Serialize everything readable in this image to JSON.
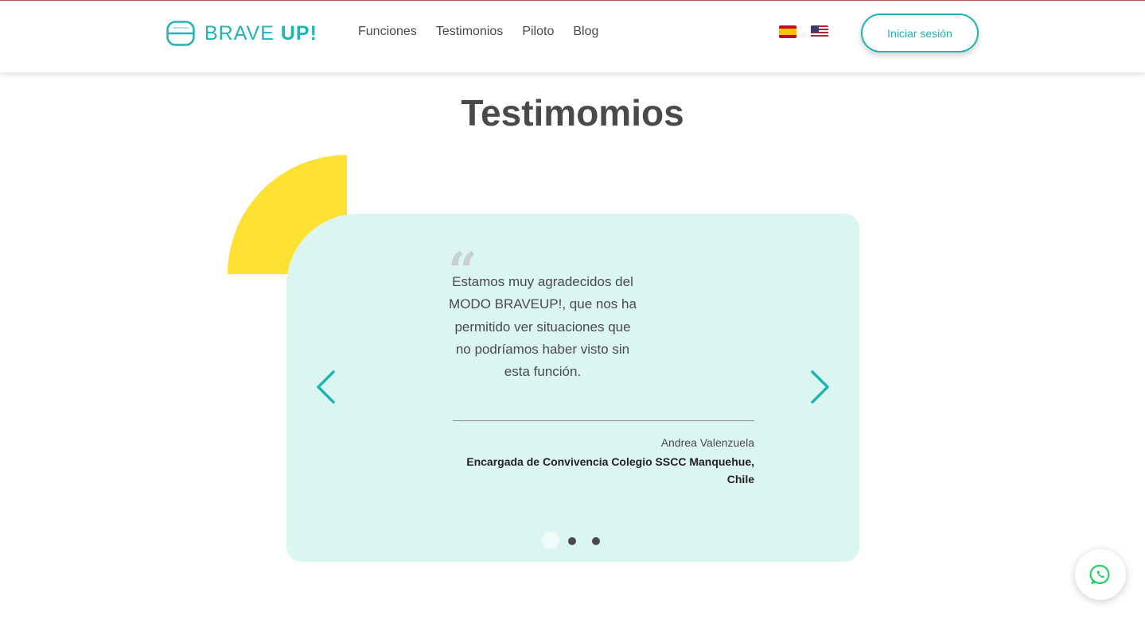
{
  "header": {
    "logo_text_light": "BRAVE ",
    "logo_text_bold": "UP!",
    "nav": [
      "Funciones",
      "Testimonios",
      "Piloto",
      "Blog"
    ],
    "login_label": "Iniciar sesión",
    "languages": [
      "es-flag-icon",
      "us-flag-icon"
    ]
  },
  "section": {
    "title": "Testimomios"
  },
  "testimonial": {
    "quote_mark": "“",
    "text": "Estamos muy agradecidos del MODO BRAVEUP!, que nos ha permitido ver situaciones que no podríamos haber visto sin esta función.",
    "author": "Andrea Valenzuela",
    "role": "Encargada de Convivencia Colegio SSCC Manquehue, Chile",
    "active_slide": 1,
    "slide_count": 3
  },
  "colors": {
    "accent": "#20b5b0",
    "card_bg": "#dbf5f1",
    "yellow": "#ffe134",
    "whatsapp": "#25d366"
  }
}
